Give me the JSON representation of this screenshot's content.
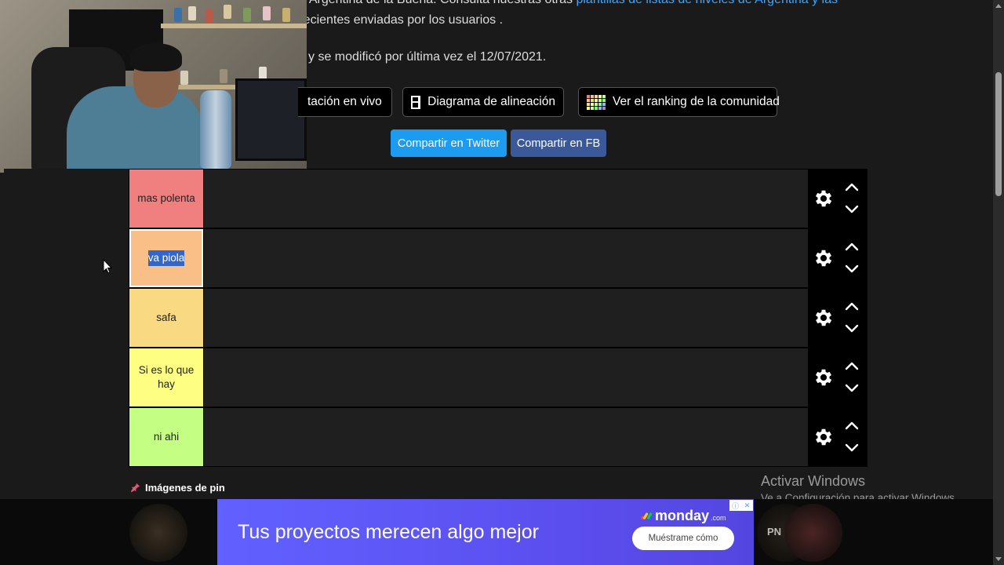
{
  "description": {
    "line1_prefix": "nida Argentina de la Bueña. Consulta nuestras otras ",
    "line1_link": "plantillas de listas de niveles de Argentina y las",
    "line2": "ás recientes enviadas por los usuarios .",
    "line3": "y se modificó por última vez el 12/07/2021."
  },
  "toolbar": {
    "live_label": "tación en vivo",
    "alignment_label": "Diagrama de alineación",
    "ranking_label": "Ver el ranking de la comunidad",
    "twitter_label": "Compartir en Twitter",
    "facebook_label": "Compartir en FB"
  },
  "tiers": [
    {
      "label": "mas polenta",
      "color": "#f08080",
      "selected": false
    },
    {
      "label": "va piola",
      "color": "#f9bf86",
      "selected": true
    },
    {
      "label": "safa",
      "color": "#fad983",
      "selected": false
    },
    {
      "label": "Si es lo que hay",
      "color": "#fefe82",
      "selected": false
    },
    {
      "label": "ni ahi",
      "color": "#c4fe82",
      "selected": false
    }
  ],
  "pin": {
    "label": "Imágenes de pin",
    "icon": "pin-icon",
    "icon_color": "#e8537a"
  },
  "windows_activation": {
    "title": "Activar Windows",
    "subtitle": "Ve a Configuración para activar Windows."
  },
  "ad": {
    "headline": "Tus proyectos merecen algo mejor",
    "brand": "monday",
    "brand_suffix": ".com",
    "cta": "Muéstrame cómo"
  },
  "bottom_bar": {
    "pn_label": "PN"
  },
  "icons": {
    "gear": "gear-icon",
    "up": "chevron-up-icon",
    "down": "chevron-down-icon",
    "alignment": "grid-icon",
    "ranking": "ranking-grid-icon"
  }
}
